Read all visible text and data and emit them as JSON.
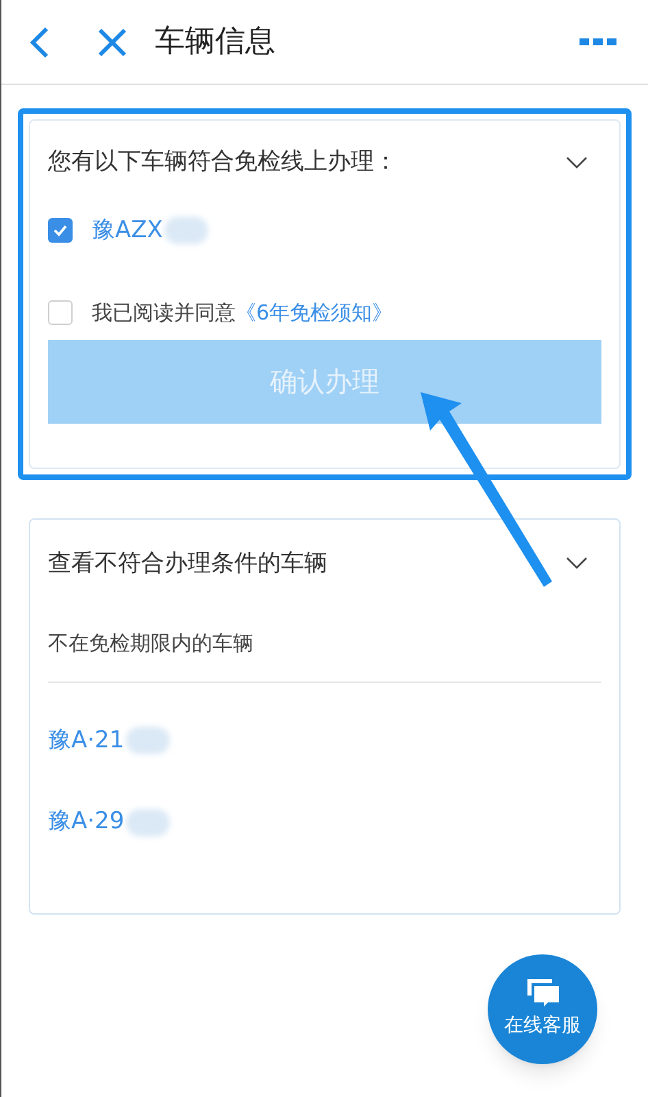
{
  "header": {
    "title": "车辆信息"
  },
  "eligible": {
    "title": "您有以下车辆符合免检线上办理：",
    "vehicles": [
      {
        "plate": "豫AZX",
        "checked": true
      }
    ],
    "agreement": {
      "checked": false,
      "text": "我已阅读并同意",
      "link": "《6年免检须知》"
    },
    "confirm_button": {
      "label": "确认办理",
      "disabled": true
    }
  },
  "ineligible": {
    "title": "查看不符合办理条件的车辆",
    "section_label": "不在免检期限内的车辆",
    "vehicles": [
      {
        "plate": "豫A·21"
      },
      {
        "plate": "豫A·29"
      }
    ]
  },
  "fab": {
    "label": "在线客服"
  }
}
